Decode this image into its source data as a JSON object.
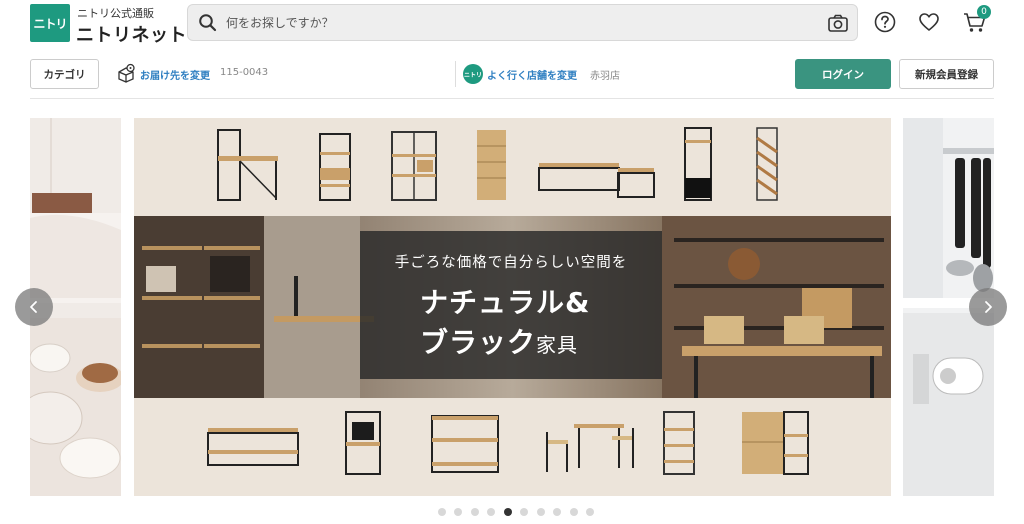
{
  "header": {
    "logo_text": "ニトリ",
    "brand_sub": "ニトリ公式通販",
    "brand_main": "ニトリネット",
    "brand_color": "#1e9a80",
    "search_placeholder": "何をお探しですか？",
    "cart_count": "0",
    "icons": [
      "search-icon",
      "camera-icon",
      "help-icon",
      "heart-icon",
      "cart-icon"
    ]
  },
  "subnav": {
    "category_label": "カテゴリ",
    "deliver_label": "お届け先を変更",
    "zip": "115-0043",
    "store_logo": "ニトリ",
    "store_label": "よく行く店舗を変更",
    "store_name": "赤羽店",
    "login_label": "ログイン",
    "register_label": "新規会員登録",
    "accent_color": "#3a9480",
    "link_color": "#2f7fc1"
  },
  "banner": {
    "subtitle": "手ごろな価格で自分らしい空間を",
    "title_line1": "ナチュラル&",
    "title_line2_main": "ブラック",
    "title_line2_small": "家具"
  },
  "carousel": {
    "dot_count": 10,
    "active_index": 4
  }
}
